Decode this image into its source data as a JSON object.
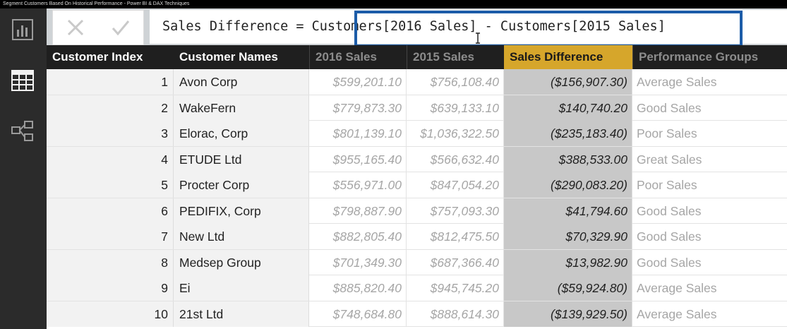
{
  "video_title": "Segment Customers Based On Historical Performance - Power BI & DAX Techniques",
  "rail": {
    "icons": [
      {
        "name": "report-view-icon",
        "active": false
      },
      {
        "name": "data-view-icon",
        "active": true
      },
      {
        "name": "relationships-view-icon",
        "active": false
      }
    ]
  },
  "formula_bar": {
    "cancel_icon": "x-icon",
    "commit_icon": "check-icon",
    "formula": "Sales Difference = Customers[2016 Sales] - Customers[2015 Sales]"
  },
  "table": {
    "columns": [
      "Customer Index",
      "Customer Names",
      "2016 Sales",
      "2015 Sales",
      "Sales Difference",
      "Performance Groups"
    ],
    "selected_column": "Sales Difference",
    "rows": [
      [
        "1",
        "Avon Corp",
        "$599,201.10",
        "$756,108.40",
        "($156,907.30)",
        "Average Sales"
      ],
      [
        "2",
        "WakeFern",
        "$779,873.30",
        "$639,133.10",
        "$140,740.20",
        "Good Sales"
      ],
      [
        "3",
        "Elorac, Corp",
        "$801,139.10",
        "$1,036,322.50",
        "($235,183.40)",
        "Poor Sales"
      ],
      [
        "4",
        "ETUDE Ltd",
        "$955,165.40",
        "$566,632.40",
        "$388,533.00",
        "Great Sales"
      ],
      [
        "5",
        "Procter Corp",
        "$556,971.00",
        "$847,054.20",
        "($290,083.20)",
        "Poor Sales"
      ],
      [
        "6",
        "PEDIFIX, Corp",
        "$798,887.90",
        "$757,093.30",
        "$41,794.60",
        "Good Sales"
      ],
      [
        "7",
        "New Ltd",
        "$882,805.40",
        "$812,475.50",
        "$70,329.90",
        "Good Sales"
      ],
      [
        "8",
        "Medsep Group",
        "$701,349.30",
        "$687,366.40",
        "$13,982.90",
        "Good Sales"
      ],
      [
        "9",
        "Ei",
        "$885,820.40",
        "$945,745.20",
        "($59,924.80)",
        "Average Sales"
      ],
      [
        "10",
        "21st Ltd",
        "$748,684.80",
        "$888,614.30",
        "($139,929.50)",
        "Average Sales"
      ]
    ]
  },
  "colors": {
    "header_bg": "#1f1f1f",
    "selected_header_bg": "#d6a62b",
    "highlight_border": "#1c5ca8",
    "rail_bg": "#2b2b2b"
  }
}
